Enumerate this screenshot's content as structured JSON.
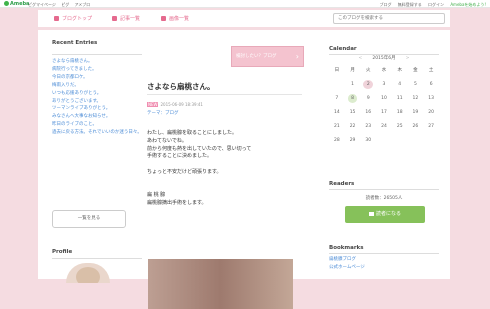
{
  "topbar": {
    "brand": "Ameba",
    "links": [
      "ピグマイページ",
      "ピグ",
      "アメブロ"
    ],
    "right_links": [
      "ブログ",
      "無料登録する",
      "ログイン"
    ],
    "green_link": "Amebaを始めよう!"
  },
  "header": {
    "nav": [
      {
        "label": "ブログトップ",
        "icon": "home-icon"
      },
      {
        "label": "記事一覧",
        "icon": "document-icon"
      },
      {
        "label": "画像一覧",
        "icon": "camera-icon"
      }
    ],
    "search_placeholder": "このブログを検索する"
  },
  "recent_entries": {
    "title": "Recent Entries",
    "items": [
      "さよなら扇桃さん。",
      "病院行ってきました。",
      "今日の京都ロケ。",
      "梅雨入りだ。",
      "いつも応援ありがとう。",
      "ありがとうございます。",
      "ツーマンライブありがとう。",
      "みなさんへ大事なお知らせ。",
      "昨日のライブのこと。",
      "過去に戻る方法。それでいいのか迷う日々。"
    ],
    "all_button": "一覧を見る"
  },
  "profile": {
    "title": "Profile"
  },
  "article": {
    "banner": "検討したい？ブログ",
    "title": "さよなら扇桃さん。",
    "tag": "NEW",
    "date": "2015-06-09 18:39:41",
    "theme": "テーマ：ブログ",
    "paragraphs": [
      "わたし、扁桃腺を取ることにしました。",
      "あわてないでね。",
      "前から何度も熱を出していたので、思い切って",
      "手術することに決めました。",
      "",
      "ちょっと不安だけど頑張ります。",
      "",
      "",
      "扁 桃 腺",
      "扁桃腺摘出手術をします。"
    ]
  },
  "calendar": {
    "title": "Calendar",
    "month": "2015年6月",
    "prev": "<",
    "next": ">",
    "weekdays": [
      "日",
      "月",
      "火",
      "水",
      "木",
      "金",
      "土"
    ],
    "days": [
      "",
      "1",
      "2",
      "3",
      "4",
      "5",
      "6",
      "7",
      "8",
      "9",
      "10",
      "11",
      "12",
      "13",
      "14",
      "15",
      "16",
      "17",
      "18",
      "19",
      "20",
      "21",
      "22",
      "23",
      "24",
      "25",
      "26",
      "27",
      "28",
      "29",
      "30",
      "",
      "",
      "",
      ""
    ],
    "today": "2",
    "posted": [
      "8"
    ]
  },
  "readers": {
    "title": "Readers",
    "count": "読者数：26505人",
    "button": "読者になる"
  },
  "bookmarks": {
    "title": "Bookmarks",
    "items": [
      "扁桃腺ブログ",
      "公式ホームページ"
    ]
  }
}
